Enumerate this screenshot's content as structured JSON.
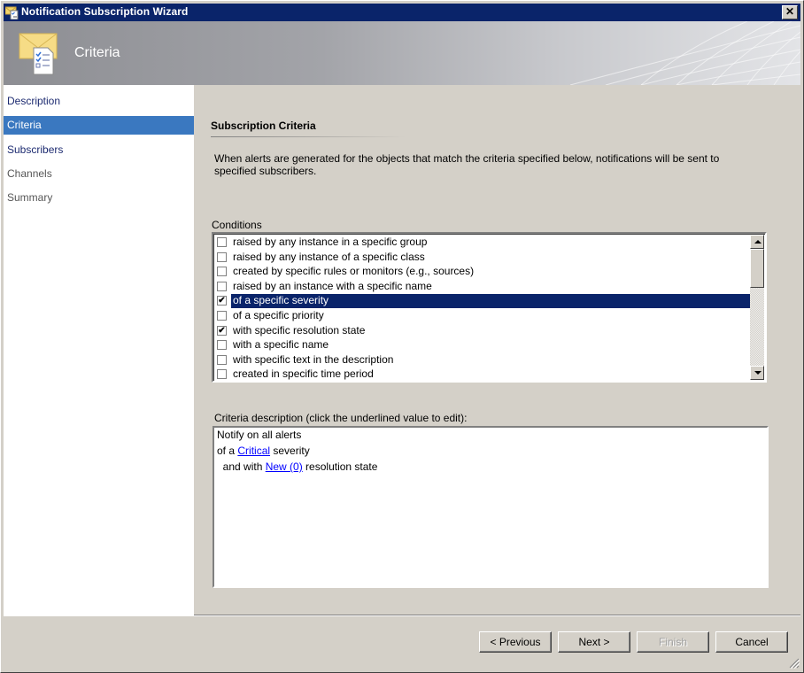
{
  "window": {
    "title": "Notification Subscription Wizard",
    "close_label": "✕"
  },
  "banner": {
    "title": "Criteria",
    "icon": "envelope-checklist-icon"
  },
  "sidebar": {
    "items": [
      {
        "label": "Description",
        "state": "done"
      },
      {
        "label": "Criteria",
        "state": "active"
      },
      {
        "label": "Subscribers",
        "state": "done"
      },
      {
        "label": "Channels",
        "state": "pending"
      },
      {
        "label": "Summary",
        "state": "pending"
      }
    ]
  },
  "main": {
    "section_title": "Subscription Criteria",
    "intro": "When alerts are generated for the objects that match the criteria specified below, notifications will be sent to specified subscribers.",
    "conditions_label": "Conditions",
    "conditions": [
      {
        "label": "raised by any instance in a specific group",
        "checked": false,
        "selected": false
      },
      {
        "label": "raised by any instance of a specific class",
        "checked": false,
        "selected": false
      },
      {
        "label": "created by specific rules or monitors (e.g., sources)",
        "checked": false,
        "selected": false
      },
      {
        "label": "raised by an instance with a specific name",
        "checked": false,
        "selected": false
      },
      {
        "label": "of a specific severity",
        "checked": true,
        "selected": true
      },
      {
        "label": "of a specific priority",
        "checked": false,
        "selected": false
      },
      {
        "label": "with specific resolution state",
        "checked": true,
        "selected": false
      },
      {
        "label": "with a specific name",
        "checked": false,
        "selected": false
      },
      {
        "label": "with specific text in the description",
        "checked": false,
        "selected": false
      },
      {
        "label": "created in specific time period",
        "checked": false,
        "selected": false
      }
    ],
    "description_label": "Criteria description (click the underlined value to edit):",
    "description": {
      "line1": "Notify on all alerts",
      "line2_prefix": "of a ",
      "line2_link": "Critical",
      "line2_suffix": " severity",
      "line3_prefix": "  and with ",
      "line3_link": "New (0)",
      "line3_suffix": " resolution state"
    }
  },
  "buttons": {
    "previous": "< Previous",
    "next": "Next >",
    "finish": "Finish",
    "cancel": "Cancel"
  },
  "colors": {
    "titlebar": "#0a246a",
    "nav_active": "#3a78c0",
    "selection": "#0a246a",
    "link": "#0000ff"
  }
}
